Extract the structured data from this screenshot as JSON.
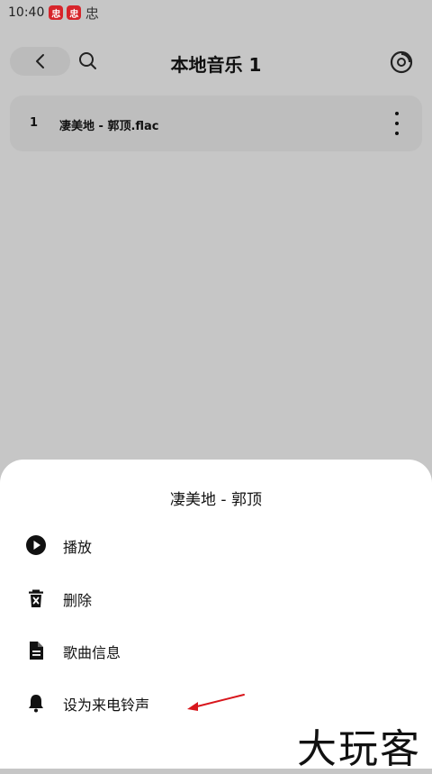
{
  "status_bar": {
    "time": "10:40",
    "icons": [
      {
        "name": "app-notification-icon",
        "glyph": "忠"
      },
      {
        "name": "app-notification-icon",
        "glyph": "忠"
      },
      {
        "name": "app-notification-icon",
        "glyph": "忠"
      }
    ]
  },
  "header": {
    "title": "本地音乐 1",
    "back_icon": "chevron-left-icon",
    "search_icon": "search-icon",
    "disc_icon": "disc-icon"
  },
  "songs": [
    {
      "index": "1",
      "name": "凄美地 - 郭顶.flac"
    }
  ],
  "sheet": {
    "title": "凄美地 - 郭顶",
    "items": [
      {
        "label": "播放",
        "icon": "play-icon"
      },
      {
        "label": "删除",
        "icon": "trash-icon"
      },
      {
        "label": "歌曲信息",
        "icon": "file-icon"
      },
      {
        "label": "设为来电铃声",
        "icon": "bell-icon"
      }
    ]
  },
  "watermark": "大玩客",
  "colors": {
    "dim_background": "#c6c6c6",
    "sheet_background": "#ffffff",
    "annotation_arrow": "#d8161c",
    "status_badge": "#d7242a"
  }
}
